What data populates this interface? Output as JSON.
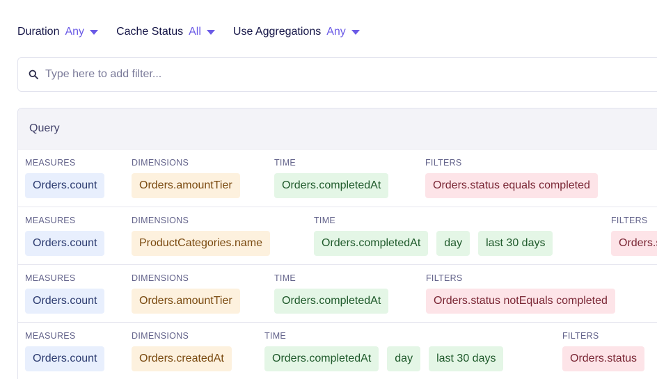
{
  "filter_bar": {
    "duration": {
      "label": "Duration",
      "value": "Any"
    },
    "cache_status": {
      "label": "Cache Status",
      "value": "All"
    },
    "use_aggregations": {
      "label": "Use Aggregations",
      "value": "Any"
    }
  },
  "search": {
    "placeholder": "Type here to add filter..."
  },
  "panel": {
    "title": "Query",
    "section_labels": {
      "measures": "MEASURES",
      "dimensions": "DIMENSIONS",
      "time": "TIME",
      "filters": "FILTERS"
    },
    "rows": [
      {
        "measures": [
          "Orders.count"
        ],
        "dimensions": [
          "Orders.amountTier"
        ],
        "time": [
          "Orders.completedAt"
        ],
        "filters": [
          "Orders.status equals completed"
        ]
      },
      {
        "measures": [
          "Orders.count"
        ],
        "dimensions": [
          "ProductCategories.name"
        ],
        "time": [
          "Orders.completedAt",
          "day",
          "last 30 days"
        ],
        "filters": [
          "Orders.status"
        ]
      },
      {
        "measures": [
          "Orders.count"
        ],
        "dimensions": [
          "Orders.amountTier"
        ],
        "time": [
          "Orders.completedAt"
        ],
        "filters": [
          "Orders.status notEquals completed"
        ]
      },
      {
        "measures": [
          "Orders.count"
        ],
        "dimensions": [
          "Orders.createdAt"
        ],
        "time": [
          "Orders.completedAt",
          "day",
          "last 30 days"
        ],
        "filters": [
          "Orders.status"
        ]
      }
    ]
  }
}
